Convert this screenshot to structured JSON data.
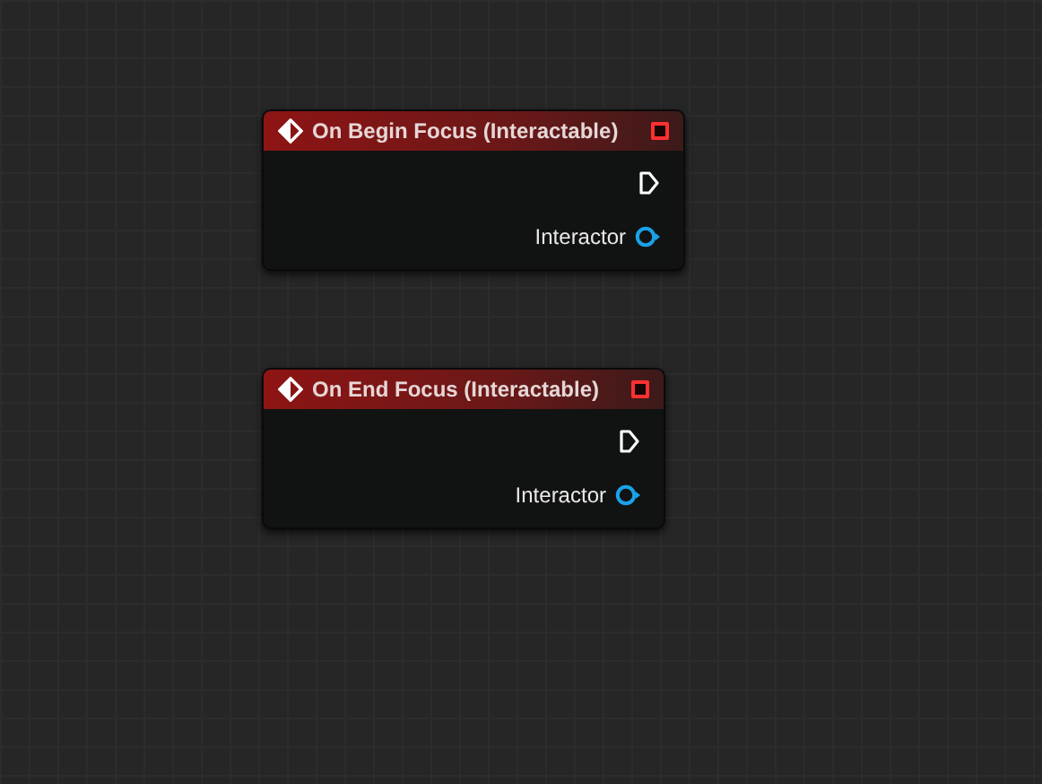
{
  "nodes": [
    {
      "title": "On Begin Focus (Interactable)",
      "pins": [
        {
          "kind": "exec"
        },
        {
          "kind": "object",
          "label": "Interactor"
        }
      ]
    },
    {
      "title": "On End Focus (Interactable)",
      "pins": [
        {
          "kind": "exec"
        },
        {
          "kind": "object",
          "label": "Interactor"
        }
      ]
    }
  ]
}
